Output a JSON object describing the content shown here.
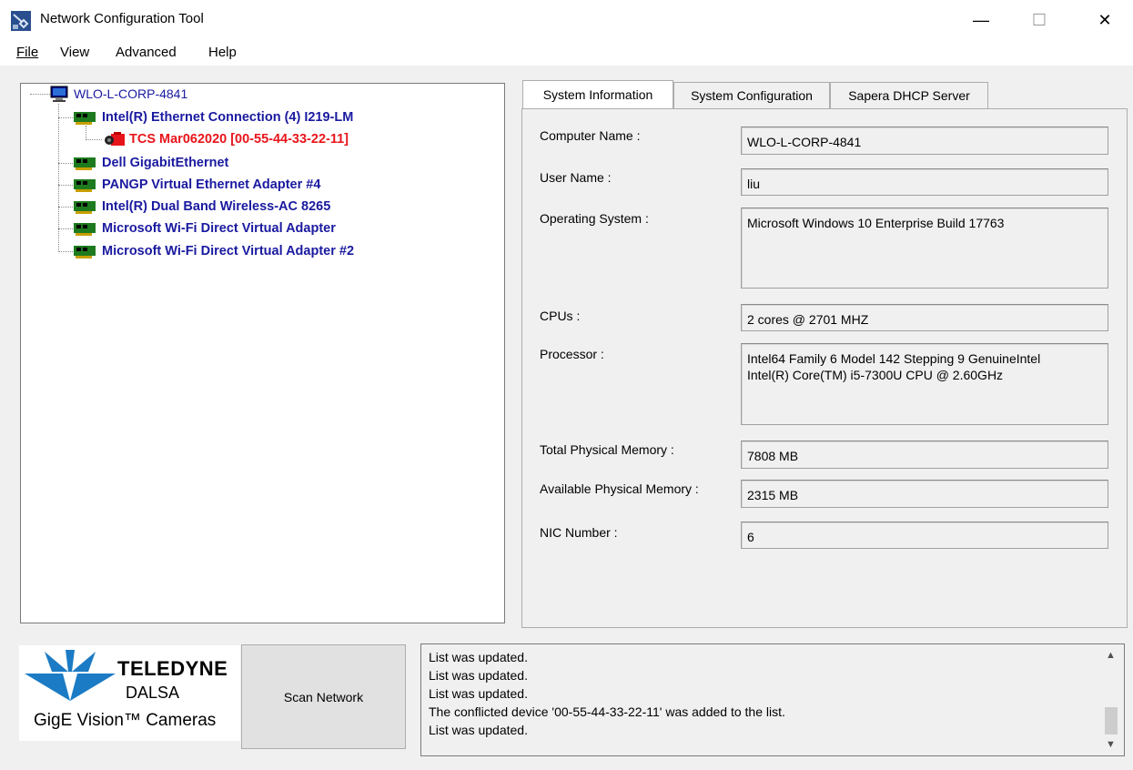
{
  "window": {
    "title": "Network Configuration Tool",
    "minimize": "—",
    "maximize": "☐",
    "close": "✕"
  },
  "menu": {
    "file": "File",
    "view": "View",
    "advanced": "Advanced",
    "help": "Help"
  },
  "tree": {
    "root": "WLO-L-CORP-4841",
    "nodes": [
      {
        "label": "Intel(R) Ethernet Connection (4) I219-LM",
        "type": "nic"
      },
      {
        "label": "TCS Mar062020 [00-55-44-33-22-11]",
        "type": "device"
      },
      {
        "label": "Dell GigabitEthernet",
        "type": "nic"
      },
      {
        "label": "PANGP Virtual Ethernet Adapter #4",
        "type": "nic"
      },
      {
        "label": "Intel(R) Dual Band Wireless-AC 8265",
        "type": "nic"
      },
      {
        "label": "Microsoft Wi-Fi Direct Virtual Adapter",
        "type": "nic"
      },
      {
        "label": "Microsoft Wi-Fi Direct Virtual Adapter #2",
        "type": "nic"
      }
    ]
  },
  "tabs": [
    "System Information",
    "System Configuration",
    "Sapera DHCP Server"
  ],
  "active_tab": "System Information",
  "system_info": {
    "computer_name_label": "Computer Name :",
    "computer_name": "WLO-L-CORP-4841",
    "user_name_label": "User Name :",
    "user_name": "liu",
    "os_label": "Operating System :",
    "os": "Microsoft Windows 10 Enterprise  Build 17763",
    "cpus_label": "CPUs :",
    "cpus": "2 cores @ 2701 MHZ",
    "processor_label": "Processor :",
    "processor": "Intel64 Family 6 Model 142 Stepping 9 GenuineIntel\nIntel(R) Core(TM) i5-7300U CPU @ 2.60GHz",
    "total_mem_label": "Total Physical Memory :",
    "total_mem": "7808 MB",
    "avail_mem_label": "Available Physical Memory :",
    "avail_mem": "2315 MB",
    "nic_number_label": "NIC Number :",
    "nic_number": "6"
  },
  "logo": {
    "brand": "TELEDYNE",
    "sub": "DALSA",
    "tagline": "GigE Vision™ Cameras"
  },
  "scan_button": "Scan Network",
  "log": [
    "List was updated.",
    "List was updated.",
    "List was updated.",
    "The conflicted device '00-55-44-33-22-11' was added to the list.",
    "List was updated."
  ],
  "colors": {
    "nic_text": "#1a1aa0",
    "conflict_text": "#e8141b",
    "logo_blue": "#1b7bc4"
  }
}
